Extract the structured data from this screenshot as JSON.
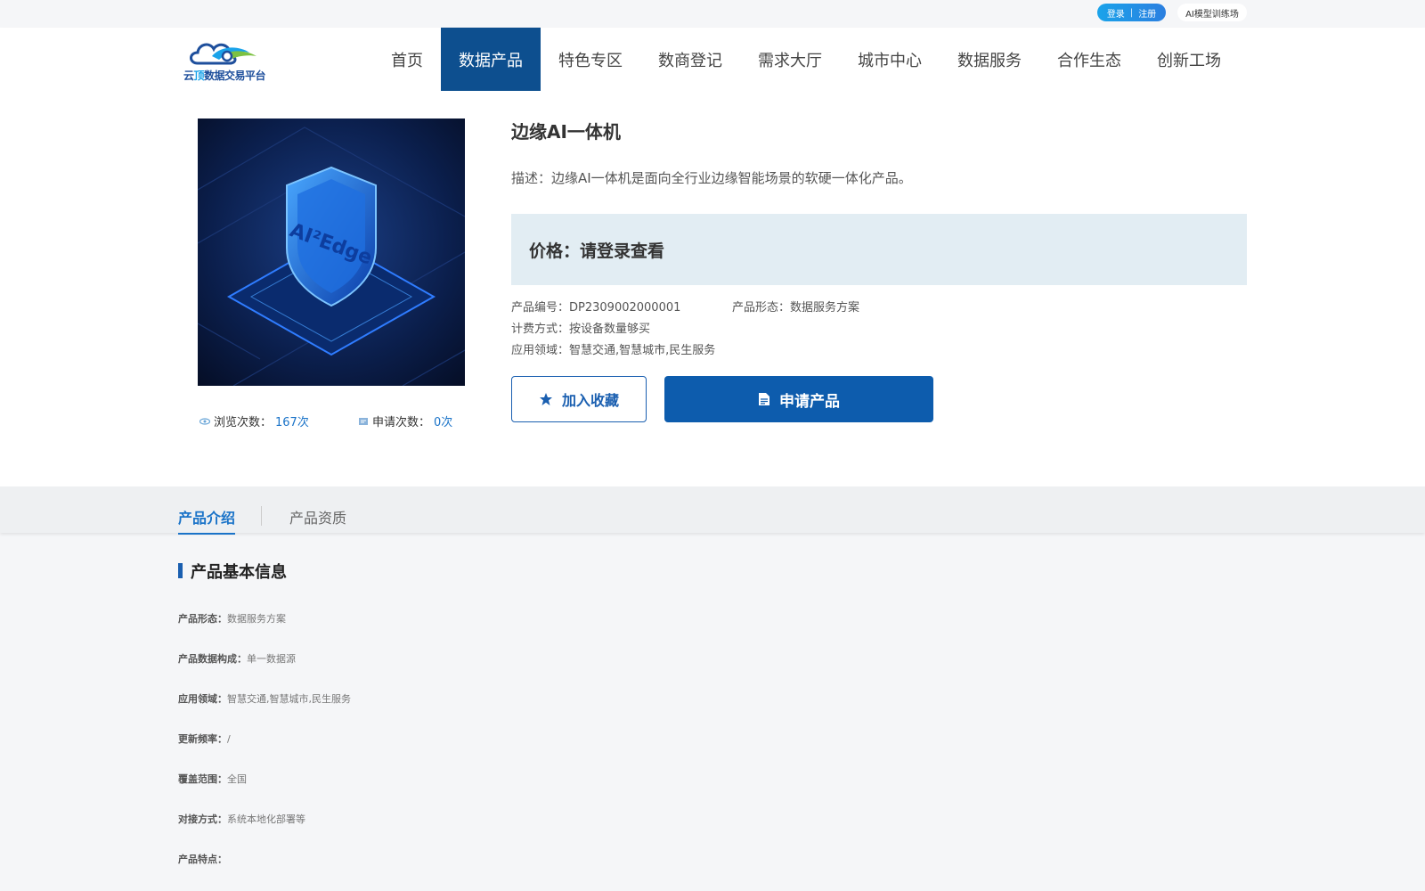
{
  "topbar": {
    "login": "登录",
    "separator": "|",
    "register": "注册",
    "ai_training": "AI模型训练场"
  },
  "logo": {
    "text_prefix": "云",
    "text_hl": "顶",
    "text_rest": "数据交易平台"
  },
  "nav": {
    "items": [
      {
        "label": "首页",
        "active": false
      },
      {
        "label": "数据产品",
        "active": true
      },
      {
        "label": "特色专区",
        "active": false
      },
      {
        "label": "数商登记",
        "active": false
      },
      {
        "label": "需求大厅",
        "active": false
      },
      {
        "label": "城市中心",
        "active": false
      },
      {
        "label": "数据服务",
        "active": false
      },
      {
        "label": "合作生态",
        "active": false
      },
      {
        "label": "创新工场",
        "active": false
      }
    ]
  },
  "product": {
    "image_text": "AI²Edge",
    "title": "边缘AI一体机",
    "description": "描述：边缘AI一体机是面向全行业边缘智能场景的软硬一体化产品。",
    "price": "价格：请登录查看",
    "code_label": "产品编号：",
    "code": "DP2309002000001",
    "form_label": "产品形态：",
    "form": "数据服务方案",
    "billing_label": "计费方式：",
    "billing": "按设备数量够买",
    "domain_label": "应用领域：",
    "domain": "智慧交通,智慧城市,民生服务",
    "views_label": "浏览次数：",
    "views": "167次",
    "applications_label": "申请次数：",
    "applications": "0次",
    "favorite_button": "加入收藏",
    "apply_button": "申请产品"
  },
  "tabs": [
    {
      "label": "产品介绍",
      "active": true
    },
    {
      "label": "产品资质",
      "active": false
    }
  ],
  "basic_info": {
    "title": "产品基本信息",
    "rows": [
      {
        "key": "产品形态：",
        "value": "数据服务方案"
      },
      {
        "key": "产品数据构成：",
        "value": "单一数据源"
      },
      {
        "key": "应用领域：",
        "value": "智慧交通,智慧城市,民生服务"
      },
      {
        "key": "更新频率：",
        "value": "/"
      },
      {
        "key": "覆盖范围：",
        "value": "全国"
      },
      {
        "key": "对接方式：",
        "value": "系统本地化部署等"
      },
      {
        "key": "产品特点：",
        "value": ""
      }
    ]
  },
  "colors": {
    "nav_active_bg": "#0d4f8f",
    "primary_button": "#0d5cad",
    "price_box_bg": "#e2edf3",
    "link_blue": "#1a73c8"
  }
}
